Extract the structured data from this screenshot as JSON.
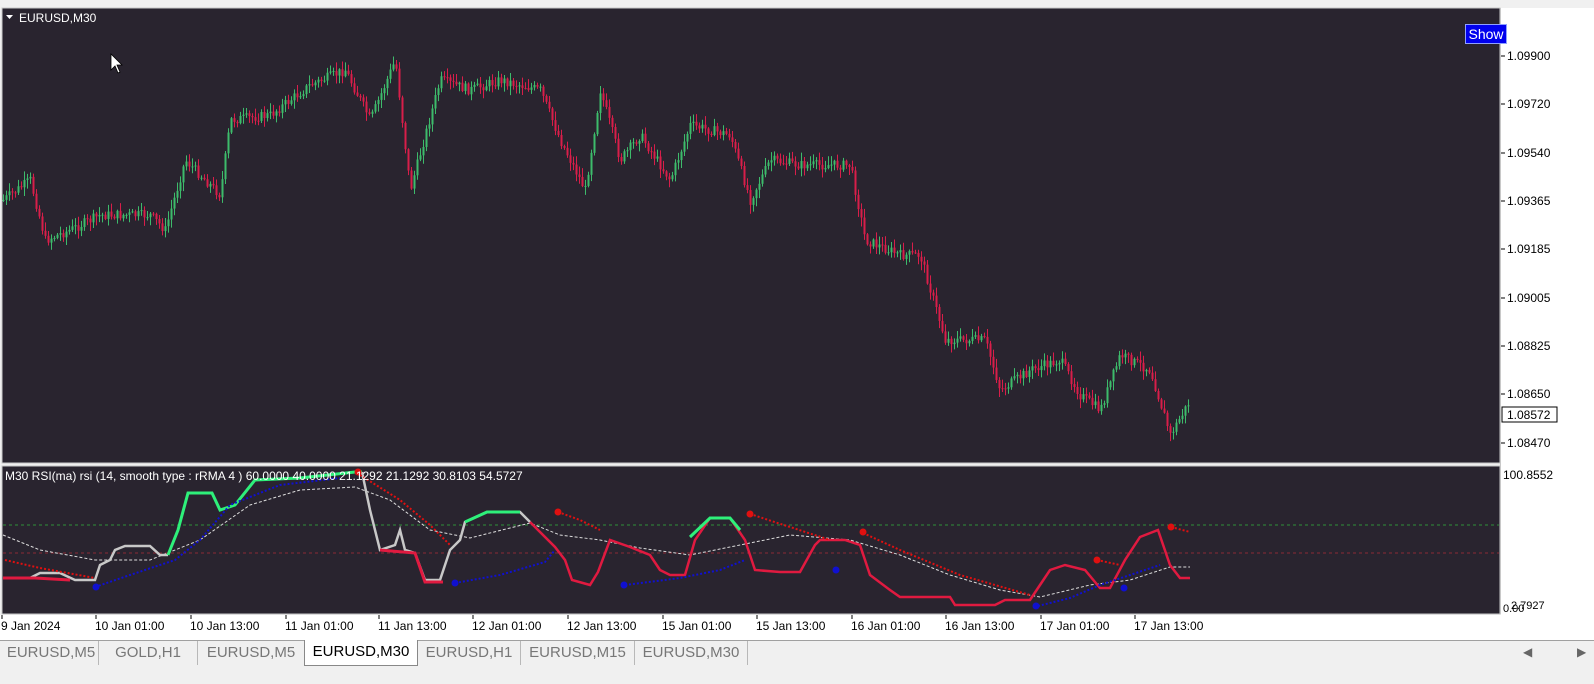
{
  "main_chart": {
    "symbol_label": "EURUSD,M30",
    "price_levels": [
      "1.09900",
      "1.09720",
      "1.09540",
      "1.09365",
      "1.09185",
      "1.09005",
      "1.08825",
      "1.08650",
      "1.08470"
    ],
    "current_price": "1.08572",
    "show_button": "Show"
  },
  "indicator": {
    "label": "M30 RSI(ma) rsi (14, smooth type : rRMA  4 ) 60.0000 40.0000 21.1292 21.1292 30.8103 54.5727",
    "top_value": "100.8552",
    "bottom_value": "0.00",
    "bottom_value_overlap": "2.7927"
  },
  "time_axis": [
    "9 Jan 2024",
    "10 Jan 01:00",
    "10 Jan 13:00",
    "11 Jan 01:00",
    "11 Jan 13:00",
    "12 Jan 01:00",
    "12 Jan 13:00",
    "15 Jan 01:00",
    "15 Jan 13:00",
    "16 Jan 01:00",
    "16 Jan 13:00",
    "17 Jan 01:00",
    "17 Jan 13:00"
  ],
  "tabs": [
    "EURUSD,M5",
    "GOLD,H1",
    "EURUSD,M5",
    "EURUSD,M30",
    "EURUSD,H1",
    "EURUSD,M15",
    "EURUSD,M30"
  ],
  "active_tab": 3,
  "colors": {
    "background": "#29242f",
    "bull": "#3dbb6b",
    "bear": "#d81e4a",
    "rsi_up": "#2ef07a",
    "rsi_down": "#e01a40",
    "rsi_neutral": "#c8c8c8",
    "dot_up": "#1010d0",
    "dot_down": "#e01010"
  }
}
